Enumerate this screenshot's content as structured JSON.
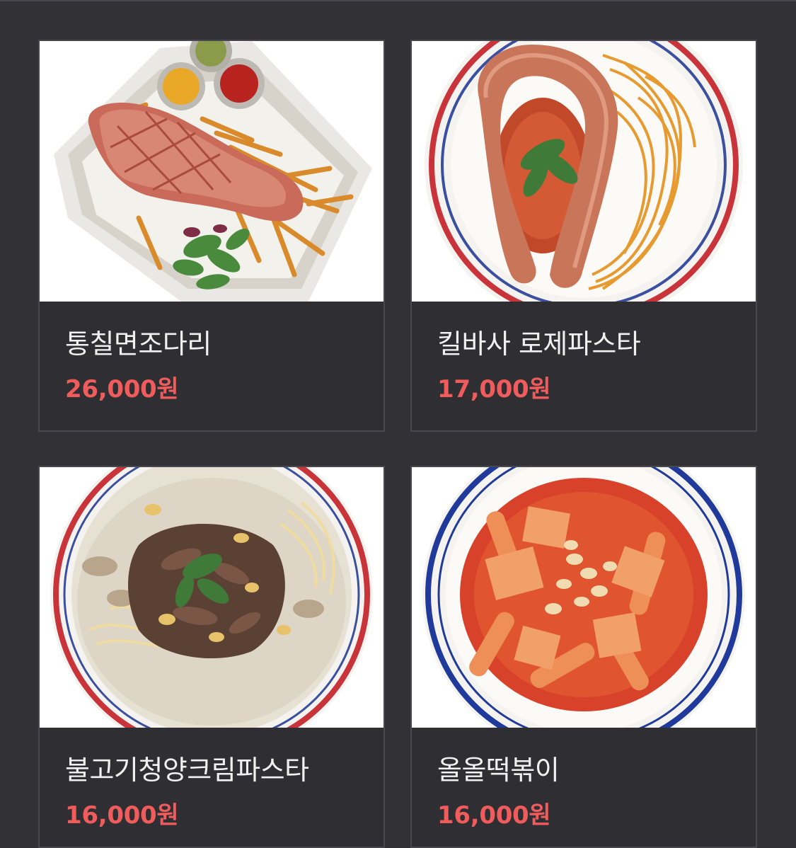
{
  "menu": {
    "items": [
      {
        "name": "통칠면조다리",
        "price": "26,000원",
        "image_icon": "turkey-leg-fries-photo"
      },
      {
        "name": "킬바사 로제파스타",
        "price": "17,000원",
        "image_icon": "kielbasa-rose-pasta-photo"
      },
      {
        "name": "불고기청양크림파스타",
        "price": "16,000원",
        "image_icon": "bulgogi-cream-pasta-photo"
      },
      {
        "name": "올올떡볶이",
        "price": "16,000원",
        "image_icon": "tteokbokki-photo"
      }
    ]
  },
  "colors": {
    "background": "#313136",
    "card_border": "#48484e",
    "name_text": "#f1f1f1",
    "price_text": "#f05b5b"
  }
}
